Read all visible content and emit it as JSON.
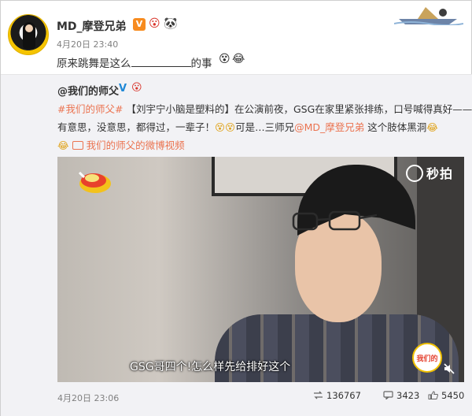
{
  "post": {
    "username": "MD_摩登兄弟",
    "verified_badge": "V",
    "emoji_1": "😮",
    "emoji_2": "🐼",
    "time": "4月20日 23:40",
    "text_before": "原来跳舞是这么",
    "text_after": "的事",
    "emoji_3": "😵",
    "emoji_4": "😂"
  },
  "retweet": {
    "user": "@我们的师父",
    "verified": "V",
    "emoji": "😮",
    "line1": {
      "hashtag": "#我们的师父#",
      "bracket": "【刘宇宁小脑是塑料的】",
      "text": "在公演前夜，GSG在家里紧张排练，口号喊得真好——"
    },
    "line2": {
      "text_a": "有意思，没意思，都得过，一辈子！",
      "emoji_a": "😵😵",
      "text_b": "可是…三师兄",
      "mention": "@MD_摩登兄弟",
      "text_c": "这个肢体黑洞",
      "emoji_b": "😂"
    },
    "line3": {
      "emoji": "😂",
      "video_link": "我们的师父的微博视频"
    },
    "video": {
      "watermark": "秒拍",
      "subtitle": "GSG哥四个!怎么样先给排好这个",
      "corner_logo": "我们的师父"
    },
    "time": "4月20日 23:06",
    "reposts": "136767",
    "comments": "3423",
    "likes": "5450"
  },
  "icons": {
    "repost": "repost-icon",
    "comment": "comment-icon",
    "like": "like-icon",
    "video": "video-link-icon",
    "mute": "mute-icon"
  },
  "colors": {
    "link": "#eb7350",
    "verified_orange": "#f78b1f",
    "verified_blue": "#1f88d6",
    "retweet_bg": "#f2f2f5"
  }
}
